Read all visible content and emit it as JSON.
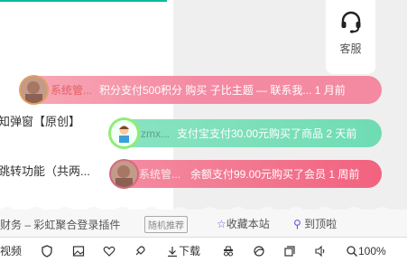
{
  "left_list": {
    "row1": "知弹窗【原创】",
    "row2": "跳转功能（共两..."
  },
  "service": {
    "label": "客服",
    "icon": "headset-icon"
  },
  "toasts": [
    {
      "name": "系统管...",
      "message": "积分支付500积分 购买 子比主题 — 联系我...  1 月前",
      "color": "#f48aa3"
    },
    {
      "name": "zmx...",
      "message": "支付宝支付30.00元购买了商品 2 天前",
      "color": "#6fdcb4"
    },
    {
      "name": "系统管...",
      "message": "余额支付99.00元购买了会员 1 周前",
      "color": "#f2627f"
    }
  ],
  "footer": {
    "link_text": "财务 – 彩虹聚合登录插件",
    "tag": "随机推荐",
    "favorite": "收藏本站",
    "to_top": "到顶啦"
  },
  "statusbar": {
    "video": "视频",
    "download": "下载",
    "zoom": "100%"
  }
}
